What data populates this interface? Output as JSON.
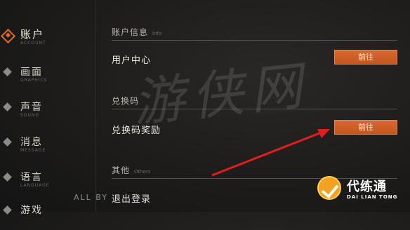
{
  "sidebar": {
    "items": [
      {
        "label": "账户",
        "sub": "ACCOUNT",
        "active": true
      },
      {
        "label": "画面",
        "sub": "GRAPHICS"
      },
      {
        "label": "声音",
        "sub": "SOUND"
      },
      {
        "label": "消息",
        "sub": "MESSAGE"
      },
      {
        "label": "语言",
        "sub": "LANGUAGE"
      },
      {
        "label": "游戏",
        "sub": ""
      }
    ]
  },
  "sections": {
    "account_info": {
      "title": "账户信息",
      "subtitle": "Info"
    },
    "redeem": {
      "title": "兑换码",
      "subtitle": ""
    },
    "other": {
      "title": "其他",
      "subtitle": "Others"
    }
  },
  "rows": {
    "user_center": {
      "label": "用户中心",
      "button": "前往"
    },
    "redeem_reward": {
      "label": "兑换码奖励",
      "button": "前往"
    }
  },
  "logout_label": "退出登录",
  "allby_text": "ALL BY",
  "watermark_text": "游侠网",
  "brand": {
    "name": "代练通",
    "en": "DAI LIAN TONG"
  },
  "colors": {
    "accent": "#d9612a",
    "arrow": "#e01e1e"
  }
}
